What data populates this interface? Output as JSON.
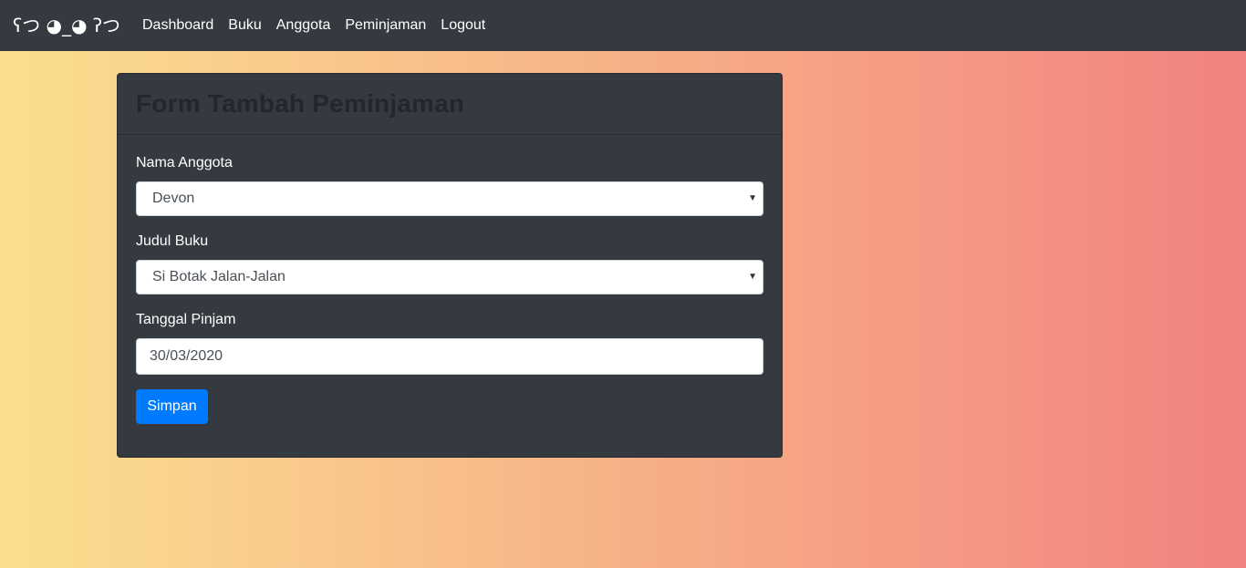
{
  "navbar": {
    "brand": "ʕつ ◕_◕ ʔつ",
    "items": [
      {
        "label": "Dashboard"
      },
      {
        "label": "Buku"
      },
      {
        "label": "Anggota"
      },
      {
        "label": "Peminjaman"
      },
      {
        "label": "Logout"
      }
    ]
  },
  "form": {
    "title": "Form Tambah Peminjaman",
    "member": {
      "label": "Nama Anggota",
      "value": "Devon"
    },
    "book": {
      "label": "Judul Buku",
      "value": "Si Botak Jalan-Jalan"
    },
    "date": {
      "label": "Tanggal Pinjam",
      "value": "30/03/2020"
    },
    "submit_label": "Simpan"
  },
  "icons": {
    "select_caret": "caret-down-icon"
  },
  "colors": {
    "navbar": "#343a40",
    "card": "#343a40",
    "primary_button": "#007bff",
    "gradient_start": "#fbdf8e",
    "gradient_end": "#f2827f"
  }
}
